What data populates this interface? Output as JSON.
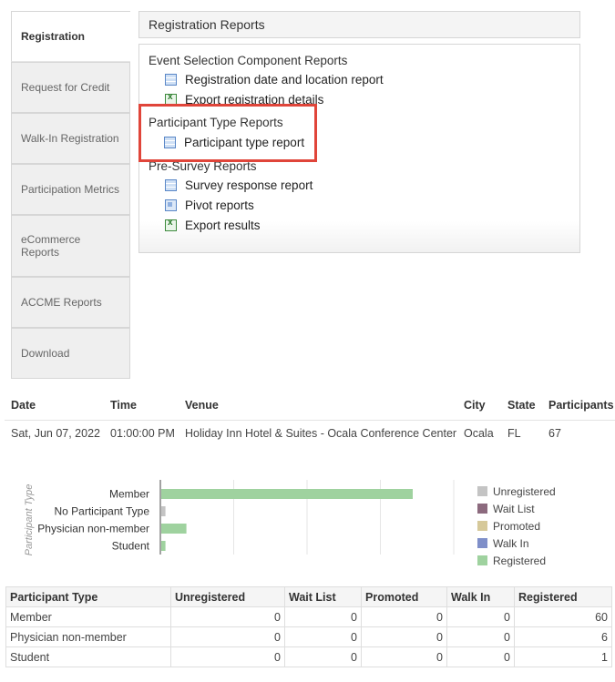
{
  "tabs": [
    {
      "label": "Registration"
    },
    {
      "label": "Request for Credit"
    },
    {
      "label": "Walk-In Registration"
    },
    {
      "label": "Participation Metrics"
    },
    {
      "label": "eCommerce Reports"
    },
    {
      "label": "ACCME Reports"
    },
    {
      "label": "Download"
    }
  ],
  "reports": {
    "header": "Registration Reports",
    "sections": {
      "event_selection": {
        "title": "Event Selection Component Reports",
        "items": [
          "Registration date and location report",
          "Export registration details"
        ]
      },
      "participant_type": {
        "title": "Participant Type Reports",
        "items": [
          "Participant type report"
        ]
      },
      "pre_survey": {
        "title": "Pre-Survey Reports",
        "items": [
          "Survey response report",
          "Pivot reports",
          "Export results"
        ]
      }
    }
  },
  "event": {
    "headers": {
      "date": "Date",
      "time": "Time",
      "venue": "Venue",
      "city": "City",
      "state": "State",
      "participants": "Participants"
    },
    "row": {
      "date": "Sat, Jun 07, 2022",
      "time": "01:00:00 PM",
      "venue": "Holiday Inn Hotel & Suites - Ocala Conference Center",
      "city": "Ocala",
      "state": "FL",
      "participants": "67"
    }
  },
  "chart_data": {
    "type": "bar",
    "orientation": "horizontal",
    "stacked": true,
    "ylabel": "Participant Type",
    "categories": [
      "Member",
      "No Participant Type",
      "Physician non-member",
      "Student"
    ],
    "series": [
      {
        "name": "Unregistered",
        "color": "#c4c4c4",
        "values": [
          0,
          1,
          0,
          0
        ]
      },
      {
        "name": "Wait List",
        "color": "#8c6a7e",
        "values": [
          0,
          0,
          0,
          0
        ]
      },
      {
        "name": "Promoted",
        "color": "#d6c99a",
        "values": [
          0,
          0,
          0,
          0
        ]
      },
      {
        "name": "Walk In",
        "color": "#7f8fc9",
        "values": [
          0,
          0,
          0,
          0
        ]
      },
      {
        "name": "Registered",
        "color": "#9fd29f",
        "values": [
          60,
          0,
          6,
          1
        ]
      }
    ],
    "xlim": [
      0,
      70
    ],
    "grid": true,
    "legend": "right"
  },
  "table": {
    "headers": [
      "Participant Type",
      "Unregistered",
      "Wait List",
      "Promoted",
      "Walk In",
      "Registered"
    ],
    "rows": [
      [
        "Member",
        "0",
        "0",
        "0",
        "0",
        "60"
      ],
      [
        "Physician non-member",
        "0",
        "0",
        "0",
        "0",
        "6"
      ],
      [
        "Student",
        "0",
        "0",
        "0",
        "0",
        "1"
      ]
    ]
  }
}
